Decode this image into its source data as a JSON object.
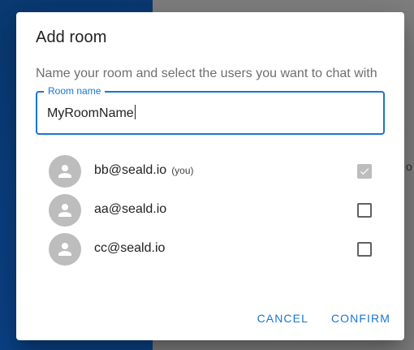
{
  "background": {
    "peek_text": "o c"
  },
  "dialog": {
    "title": "Add room",
    "description": "Name your room and select the users you want to chat with",
    "room_name_field": {
      "label": "Room name",
      "value": "MyRoomName"
    },
    "users": [
      {
        "email": "bb@seald.io",
        "tag": "(you)",
        "checked": true,
        "disabled": true
      },
      {
        "email": "aa@seald.io",
        "tag": "",
        "checked": false,
        "disabled": false
      },
      {
        "email": "cc@seald.io",
        "tag": "",
        "checked": false,
        "disabled": false
      }
    ],
    "actions": {
      "cancel_label": "CANCEL",
      "confirm_label": "CONFIRM"
    }
  },
  "colors": {
    "accent": "#1976d2",
    "avatar_bg": "#bdbdbd",
    "backdrop_left": "#0b3f80",
    "backdrop_right": "#7f7f7f"
  },
  "icons": {
    "avatar": "person-icon",
    "checked": "check-icon"
  }
}
